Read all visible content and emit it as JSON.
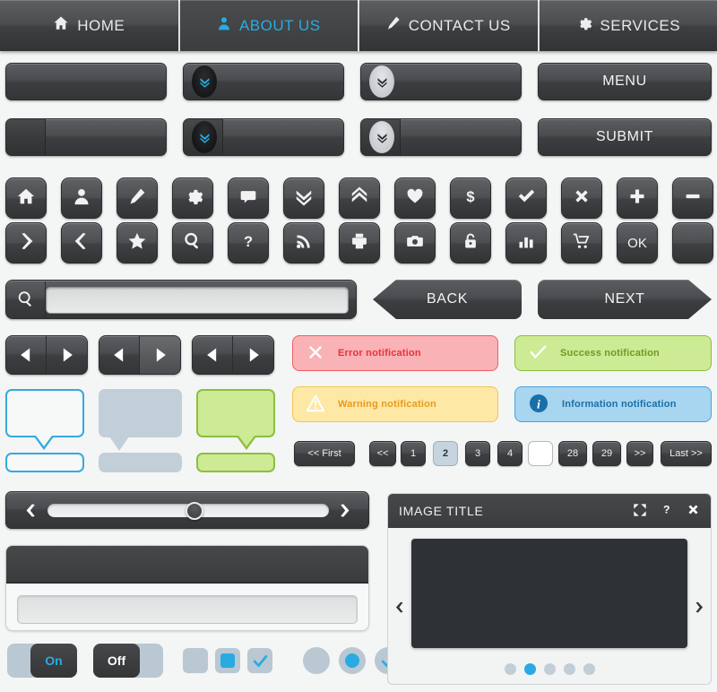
{
  "nav": {
    "tabs": [
      {
        "label": "HOME",
        "icon": "home-icon",
        "active": false
      },
      {
        "label": "ABOUT US",
        "icon": "user-icon",
        "active": true
      },
      {
        "label": "CONTACT US",
        "icon": "pencil-icon",
        "active": false
      },
      {
        "label": "SERVICES",
        "icon": "gear-icon",
        "active": false
      }
    ],
    "active_color": "#29abe2"
  },
  "wide_buttons": {
    "row1": [
      {
        "label": "",
        "variant": "plain"
      },
      {
        "label": "",
        "variant": "badge-dark",
        "icon": "double-chevron-down-icon"
      },
      {
        "label": "",
        "variant": "badge-light",
        "icon": "double-chevron-down-icon"
      },
      {
        "label": "MENU",
        "variant": "plain"
      }
    ],
    "row2": [
      {
        "label": "",
        "variant": "split"
      },
      {
        "label": "",
        "variant": "split-badge-dark",
        "icon": "double-chevron-down-icon"
      },
      {
        "label": "",
        "variant": "split-badge-light",
        "icon": "double-chevron-down-icon"
      },
      {
        "label": "SUBMIT",
        "variant": "plain"
      }
    ]
  },
  "icon_grid": {
    "row1": [
      "home-icon",
      "user-icon",
      "pencil-icon",
      "gear-icon",
      "comment-icon",
      "double-chevron-down-icon",
      "double-chevron-up-icon",
      "heart-icon",
      "dollar-icon",
      "check-icon",
      "close-icon",
      "plus-icon",
      "minus-icon"
    ],
    "row2": [
      "chevron-right-icon",
      "chevron-left-icon",
      "star-icon",
      "search-icon",
      "question-icon",
      "rss-icon",
      "print-icon",
      "camera-icon",
      "lock-icon",
      "chart-icon",
      "cart-icon",
      "ok-label",
      "blank-icon"
    ],
    "ok_label": "OK"
  },
  "search": {
    "icon": "search-icon",
    "value": "",
    "placeholder": ""
  },
  "wizard": {
    "back_label": "BACK",
    "next_label": "NEXT"
  },
  "pager_pairs": [
    {
      "prev_icon": "triangle-left-icon",
      "next_icon": "triangle-right-icon"
    },
    {
      "prev_icon": "triangle-left-icon",
      "next_icon": "triangle-right-icon"
    },
    {
      "prev_icon": "triangle-left-icon",
      "next_icon": "triangle-right-icon"
    }
  ],
  "notifications": [
    {
      "type": "error",
      "message": "Error notification",
      "icon": "x-circle-icon",
      "bg": "#f9b2b5",
      "border": "#ef5f69",
      "text": "#e8323c"
    },
    {
      "type": "success",
      "message": "Success notification",
      "icon": "check-icon",
      "bg": "#cdea94",
      "border": "#8cbf3f",
      "text": "#6f9a24"
    },
    {
      "type": "warning",
      "message": "Warning notification",
      "icon": "warning-icon",
      "bg": "#fde8a6",
      "border": "#f3c44a",
      "text": "#e79b20"
    },
    {
      "type": "info",
      "message": "Information notification",
      "icon": "info-icon",
      "bg": "#a8d5f0",
      "border": "#4ba3dd",
      "text": "#1a6fa8"
    }
  ],
  "bubbles": [
    {
      "style": "outline-blue",
      "bg": "#f7f8f8",
      "border": "#35a9e0",
      "tail": "center"
    },
    {
      "style": "solid-grey",
      "bg": "#c2ced8",
      "border": "#c2ced8",
      "tail": "left"
    },
    {
      "style": "solid-green",
      "bg": "#cdea94",
      "border": "#8cbf3f",
      "tail": "right"
    }
  ],
  "pagination": {
    "first_label": "<< First",
    "prev_label": "<<",
    "next_label": ">>",
    "last_label": "Last >>",
    "pages": [
      {
        "label": "1",
        "state": "normal"
      },
      {
        "label": "2",
        "state": "active"
      },
      {
        "label": "3",
        "state": "normal"
      },
      {
        "label": "4",
        "state": "normal"
      },
      {
        "label": "",
        "state": "blank"
      },
      {
        "label": "28",
        "state": "normal"
      },
      {
        "label": "29",
        "state": "normal"
      }
    ]
  },
  "slider": {
    "prev_icon": "chevron-left-icon",
    "next_icon": "chevron-right-icon",
    "handle_position_pct": 50
  },
  "panel": {
    "header_title": "",
    "input_value": "",
    "input_placeholder": ""
  },
  "toggles": [
    {
      "label": "On",
      "state": "on"
    },
    {
      "label": "Off",
      "state": "off"
    }
  ],
  "checkboxes": [
    {
      "state": "empty"
    },
    {
      "state": "filled"
    },
    {
      "state": "checked"
    }
  ],
  "radios": [
    {
      "state": "empty"
    },
    {
      "state": "filled"
    },
    {
      "state": "checked"
    }
  ],
  "viewer": {
    "title": "IMAGE TITLE",
    "tools": [
      "expand-icon",
      "help-icon",
      "close-icon"
    ],
    "prev_icon": "chevron-left-icon",
    "next_icon": "chevron-right-icon",
    "dots": 5,
    "active_dot": 2
  },
  "colors": {
    "accent": "#29abe2",
    "background": "#f4f5f5",
    "button_dark": "#46484a",
    "pagination_active": "#c5d4de"
  }
}
